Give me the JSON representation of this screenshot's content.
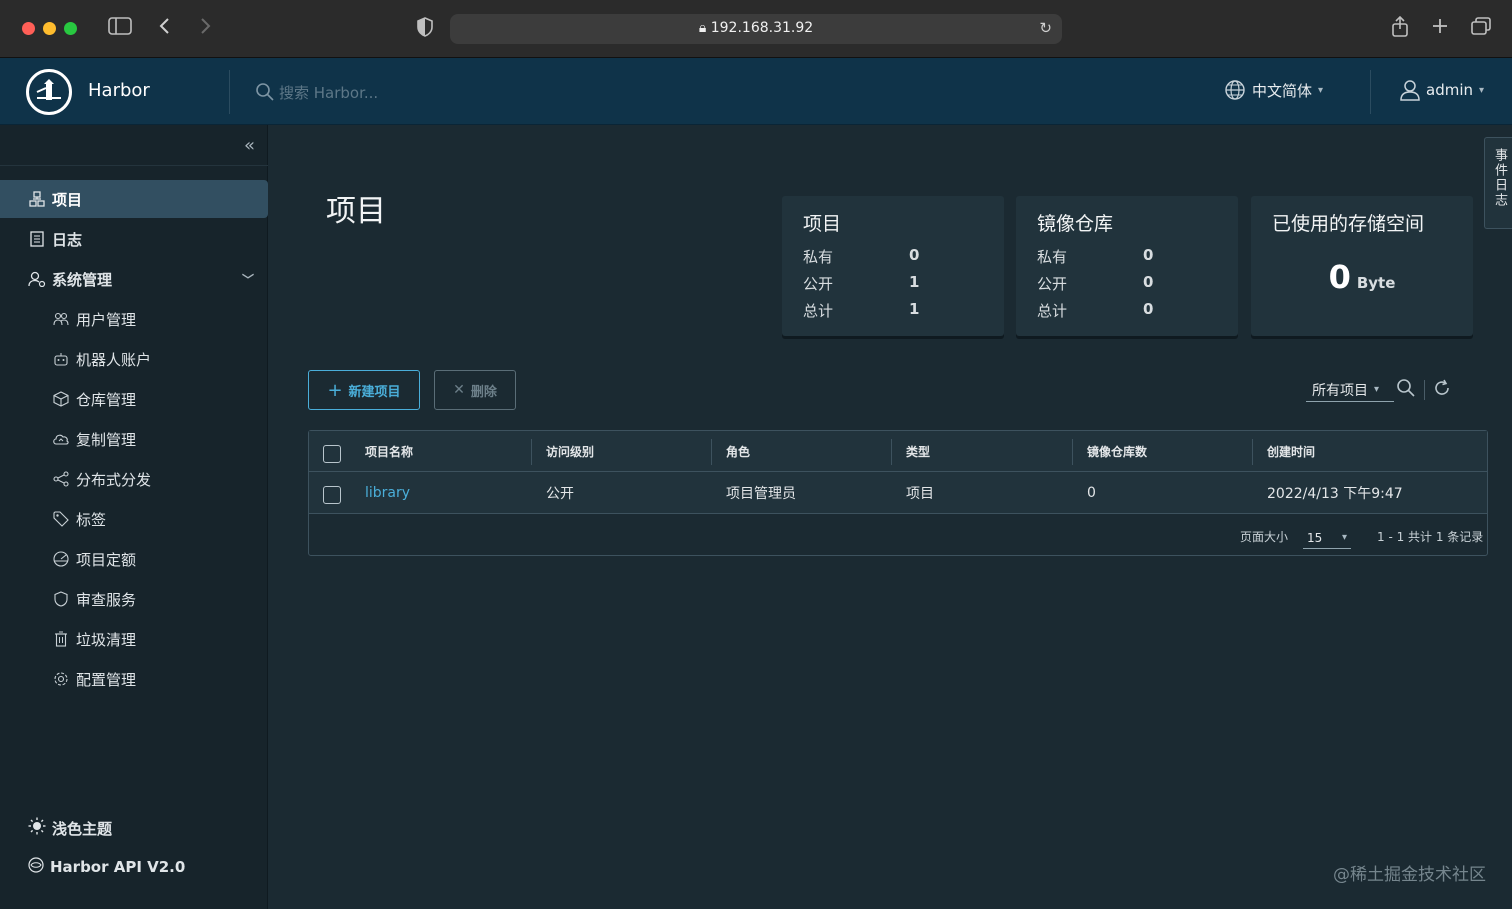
{
  "browser": {
    "url": "192.168.31.92"
  },
  "header": {
    "brand": "Harbor",
    "search_placeholder": "搜索 Harbor...",
    "language": "中文简体",
    "user": "admin"
  },
  "sidebar": {
    "items": [
      {
        "label": "项目",
        "icon": "projects-icon",
        "active": true
      },
      {
        "label": "日志",
        "icon": "log-icon"
      },
      {
        "label": "系统管理",
        "icon": "admin-icon",
        "expanded": true
      }
    ],
    "sub_items": [
      {
        "label": "用户管理",
        "icon": "users-icon"
      },
      {
        "label": "机器人账户",
        "icon": "robot-icon"
      },
      {
        "label": "仓库管理",
        "icon": "registry-icon"
      },
      {
        "label": "复制管理",
        "icon": "replication-icon"
      },
      {
        "label": "分布式分发",
        "icon": "share-icon"
      },
      {
        "label": "标签",
        "icon": "tag-icon"
      },
      {
        "label": "项目定额",
        "icon": "quota-icon"
      },
      {
        "label": "审查服务",
        "icon": "shield-icon"
      },
      {
        "label": "垃圾清理",
        "icon": "trash-icon"
      },
      {
        "label": "配置管理",
        "icon": "gear-icon"
      }
    ],
    "light_theme": "浅色主题",
    "api": "Harbor API V2.0"
  },
  "page": {
    "title": "项目",
    "side_tab": "事件日志"
  },
  "cards": {
    "projects": {
      "title": "项目",
      "rows": [
        {
          "label": "私有",
          "value": "0"
        },
        {
          "label": "公开",
          "value": "1"
        },
        {
          "label": "总计",
          "value": "1"
        }
      ]
    },
    "repos": {
      "title": "镜像仓库",
      "rows": [
        {
          "label": "私有",
          "value": "0"
        },
        {
          "label": "公开",
          "value": "0"
        },
        {
          "label": "总计",
          "value": "0"
        }
      ]
    },
    "storage": {
      "title": "已使用的存储空间",
      "value": "0",
      "unit": "Byte"
    }
  },
  "toolbar": {
    "new_project": "新建项目",
    "delete": "删除",
    "filter": "所有项目"
  },
  "table": {
    "columns": [
      "项目名称",
      "访问级别",
      "角色",
      "类型",
      "镜像仓库数",
      "创建时间"
    ],
    "rows": [
      {
        "name": "library",
        "access": "公开",
        "role": "项目管理员",
        "type": "项目",
        "repo_count": "0",
        "created": "2022/4/13 下午9:47"
      }
    ],
    "page_size_label": "页面大小",
    "page_size": "15",
    "summary": "1 - 1 共计 1 条记录"
  },
  "watermark": "@稀土掘金技术社区",
  "colors": {
    "header_bg": "#0f3349",
    "sidebar_bg": "#17242b",
    "main_bg": "#1b2a32",
    "accent": "#4aaed9"
  }
}
